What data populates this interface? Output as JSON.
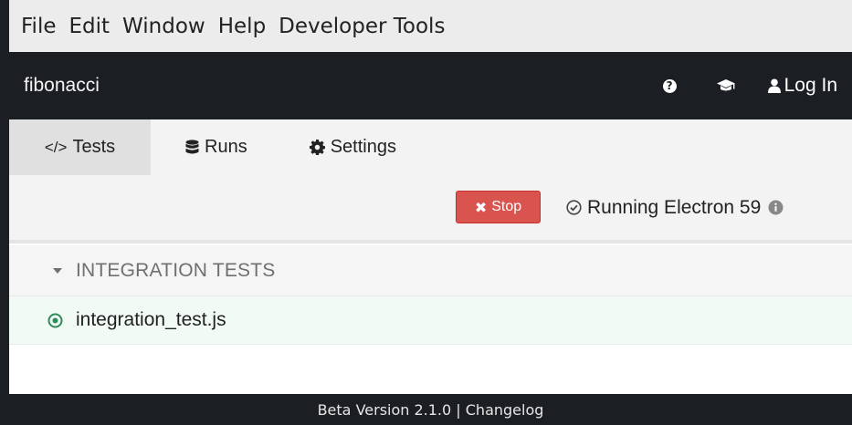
{
  "menubar": {
    "items": [
      "File",
      "Edit",
      "Window",
      "Help",
      "Developer Tools"
    ]
  },
  "navbar": {
    "project": "fibonacci",
    "help_icon": "question-circle-icon",
    "docs_icon": "graduation-cap-icon",
    "login_label": "Log In"
  },
  "tabs": [
    {
      "label": "Tests",
      "icon": "code-icon",
      "active": true
    },
    {
      "label": "Runs",
      "icon": "database-icon",
      "active": false
    },
    {
      "label": "Settings",
      "icon": "gear-icon",
      "active": false
    }
  ],
  "toolbar": {
    "stop_label": "Stop",
    "status_text": "Running Electron 59"
  },
  "specs": {
    "folder": "INTEGRATION TESTS",
    "files": [
      "integration_test.js"
    ]
  },
  "footer": {
    "text": "Beta Version 2.1.0 | Changelog"
  },
  "colors": {
    "dark": "#1b1e23",
    "stop": "#d9534f",
    "running_green": "#2e8b57"
  }
}
